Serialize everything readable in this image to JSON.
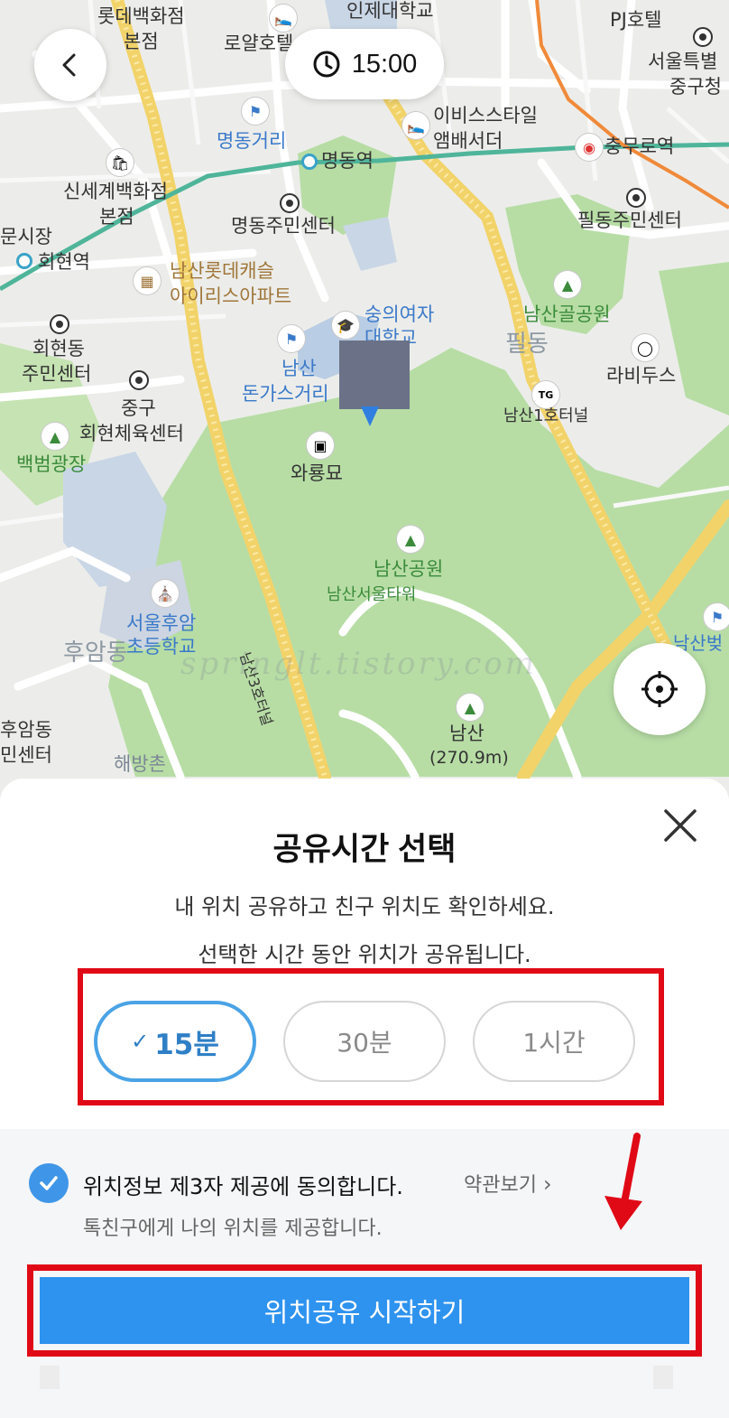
{
  "map": {
    "labels": {
      "lotte_dept": "롯데백화점",
      "lotte_dept_main": "본점",
      "royal_hotel": "로얄호텔",
      "inje_univ": "인제대학교",
      "pj_hotel": "PJ호텔",
      "seoul_special": "서울특별",
      "jung_gu_office": "중구청",
      "myeongdong_street": "명동거리",
      "ibis_1": "이비스스타일",
      "ibis_2": "앰배서더",
      "myeongdong_station": "명동역",
      "chungmuro_station": "충무로역",
      "shinsegae_1": "신세계백화점",
      "shinsegae_2": "본점",
      "myeongdong_center": "명동주민센터",
      "pildong_center": "필동주민센터",
      "market": "문시장",
      "hoehyeon_station": "회현역",
      "namsan_lotte_1": "남산롯데캐슬",
      "namsan_lotte_2": "아이리스아파트",
      "sookmyung_1": "숭의여자",
      "sookmyung_2": "대학교",
      "namsangol": "남산골공원",
      "hoehyeon_center_1": "회현동",
      "hoehyeon_center_2": "주민센터",
      "namsan_donkatsu_1": "남산",
      "namsan_donkatsu_2": "돈가스거리",
      "pildong": "필동",
      "rabidus": "라비두스",
      "junggu_gym_1": "중구",
      "junggu_gym_2": "회현체육센터",
      "namsan_tunnel": "남산1호터널",
      "tg": "TG",
      "baekbeom": "백범광장",
      "wayongmyo": "와룡묘",
      "namsan_park": "남산공원",
      "namsan_tower": "남산서울타워",
      "huam_school_1": "서울후암",
      "huam_school_2": "초등학교",
      "huam": "후암동",
      "namsan_peak": "남산",
      "namsan_height": "(270.9m)",
      "huam_center_1": "후암동",
      "huam_center_2": "민센터",
      "haebangchon": "해방촌",
      "tunnel3": "남산3호터널",
      "namsan_byeot": "남산벚"
    },
    "watermark": "springlt.tistory.com"
  },
  "header": {
    "timer_value": "15:00"
  },
  "sheet": {
    "title": "공유시간 선택",
    "description_line1": "내 위치 공유하고 친구 위치도 확인하세요.",
    "description_line2": "선택한 시간 동안 위치가 공유됩니다.",
    "options": [
      {
        "label": "15분",
        "selected": true
      },
      {
        "label": "30분",
        "selected": false
      },
      {
        "label": "1시간",
        "selected": false
      }
    ],
    "consent": {
      "label": "위치정보 제3자 제공에 동의합니다.",
      "terms_link": "약관보기",
      "sub_text": "톡친구에게 나의 위치를 제공합니다.",
      "checked": true
    },
    "start_button": "위치공유 시작하기"
  },
  "colors": {
    "accent_blue": "#2e93ef",
    "selected_border": "#4aa3e6",
    "annotation_red": "#e00916",
    "park_green": "#b7dda5"
  }
}
